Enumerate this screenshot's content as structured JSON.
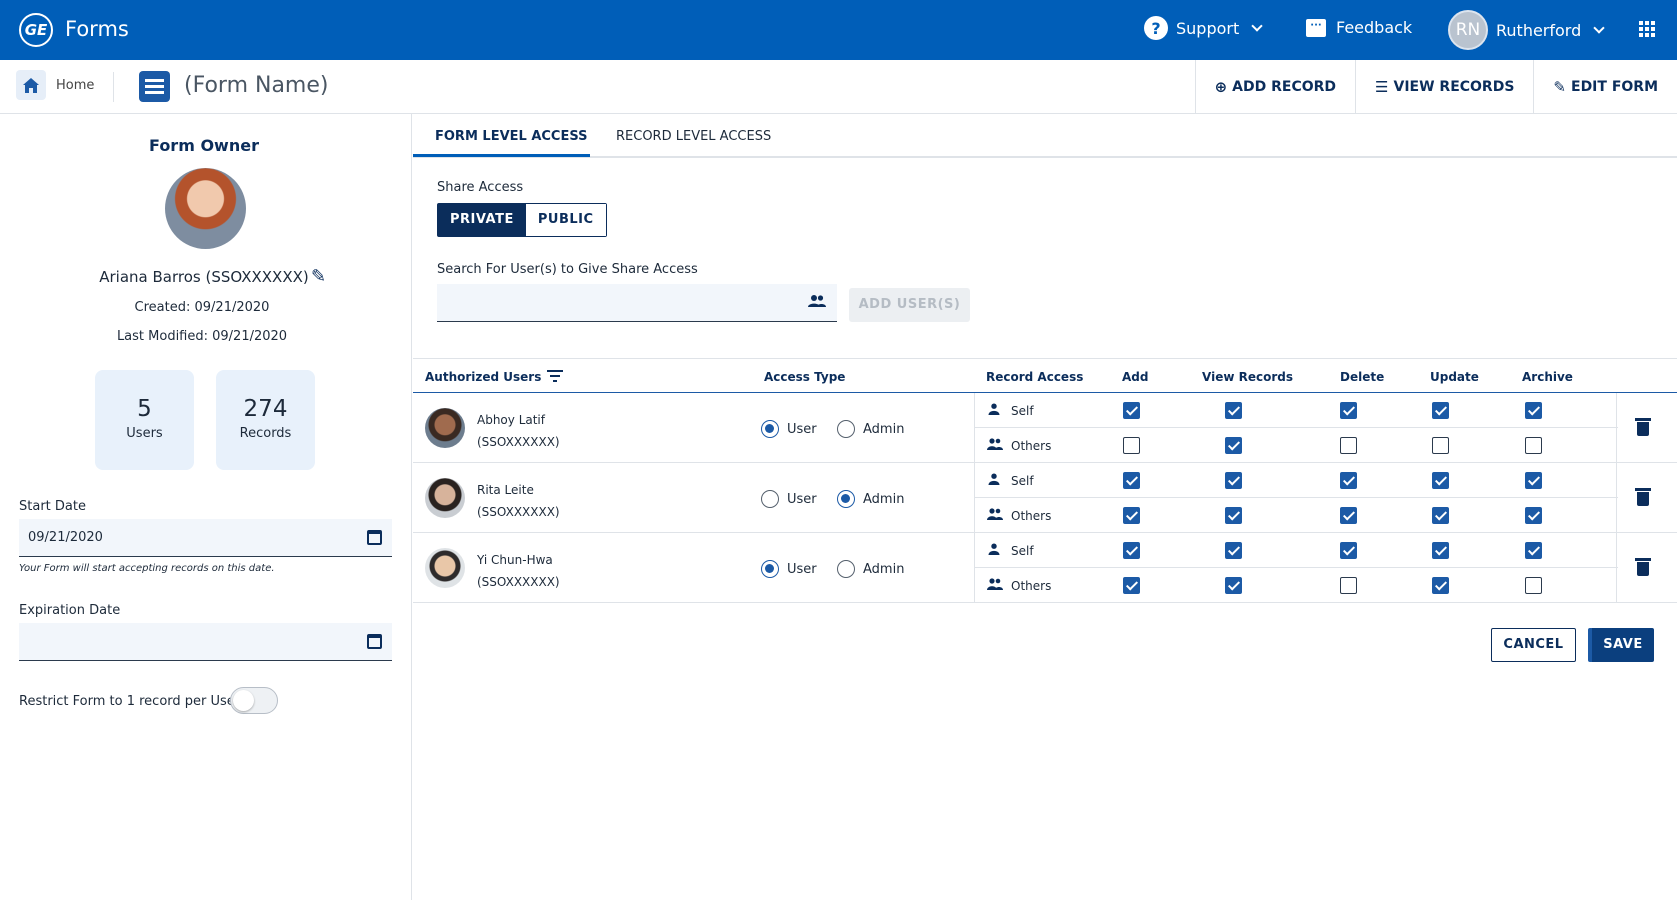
{
  "topbar": {
    "app_title": "Forms",
    "logo_text": "GE",
    "support_label": "Support",
    "feedback_label": "Feedback",
    "user_initials": "RN",
    "user_name": "Rutherford"
  },
  "subbar": {
    "home_label": "Home",
    "form_name": "(Form Name)",
    "actions": [
      "ADD RECORD",
      "VIEW RECORDS",
      "EDIT FORM"
    ]
  },
  "owner": {
    "title": "Form Owner",
    "name": "Ariana Barros (SSOXXXXXX)",
    "created": "Created: 09/21/2020",
    "modified": "Last Modified: 09/21/2020",
    "users_count": "5",
    "users_label": "Users",
    "records_count": "274",
    "records_label": "Records"
  },
  "dates": {
    "start_label": "Start Date",
    "start_value": "09/21/2020",
    "start_hint": "Your Form will start accepting records on this date.",
    "expiration_label": "Expiration Date",
    "expiration_value": ""
  },
  "restrict": {
    "label": "Restrict Form to 1 record per User",
    "enabled": false
  },
  "tabs": [
    "FORM LEVEL ACCESS",
    "RECORD LEVEL ACCESS"
  ],
  "share": {
    "label": "Share Access",
    "options": [
      "PRIVATE",
      "PUBLIC"
    ],
    "selected": "PRIVATE",
    "search_label": "Search For User(s) to Give Share Access",
    "search_value": "",
    "add_users_label": "ADD USER(S)"
  },
  "table": {
    "headers": [
      "Authorized Users",
      "Access Type",
      "Record Access",
      "Add",
      "View Records",
      "Delete",
      "Update",
      "Archive"
    ],
    "access_options": [
      "User",
      "Admin"
    ],
    "scope_labels": [
      "Self",
      "Others"
    ],
    "rows": [
      {
        "name": "Abhoy Latif",
        "sso": "(SSOXXXXXX)",
        "access": "User",
        "self": [
          true,
          true,
          true,
          true,
          true
        ],
        "others": [
          false,
          true,
          false,
          false,
          false
        ]
      },
      {
        "name": "Rita Leite",
        "sso": "(SSOXXXXXX)",
        "access": "Admin",
        "self": [
          true,
          true,
          true,
          true,
          true
        ],
        "others": [
          true,
          true,
          true,
          true,
          true
        ]
      },
      {
        "name": "Yi Chun-Hwa",
        "sso": "(SSOXXXXXX)",
        "access": "User",
        "self": [
          true,
          true,
          true,
          true,
          true
        ],
        "others": [
          true,
          true,
          false,
          true,
          false
        ]
      }
    ]
  },
  "buttons": {
    "cancel": "CANCEL",
    "save": "SAVE"
  },
  "colors": {
    "brand": "#005eb8",
    "navy": "#0b2d5b",
    "accent": "#1c5aa6"
  }
}
